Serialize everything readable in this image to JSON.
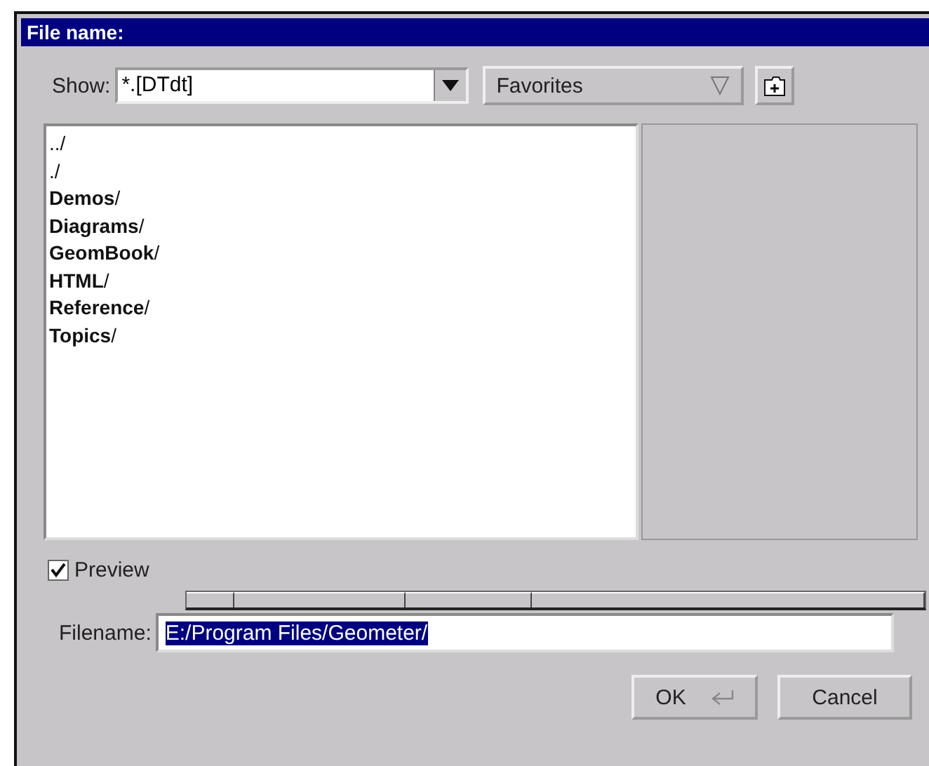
{
  "window": {
    "title": "File name:"
  },
  "filter": {
    "label": "Show:",
    "value": "*.[DTdt]"
  },
  "favorites": {
    "label": "Favorites"
  },
  "files": [
    {
      "name": "../"
    },
    {
      "name": "./"
    },
    {
      "name": "**Demos**/"
    },
    {
      "name": "**Diagrams**/"
    },
    {
      "name": "**GeomBook**/"
    },
    {
      "name": "**HTML**/"
    },
    {
      "name": "**Reference**/"
    },
    {
      "name": "**Topics**/"
    }
  ],
  "preview": {
    "label": "Preview",
    "checked": true
  },
  "filename": {
    "label": "Filename:",
    "value": "E:/Program Files/Geometer/",
    "text_selected": true
  },
  "buttons": [
    {
      "label": "OK",
      "kind": "ok"
    },
    {
      "label": "Cancel",
      "kind": "cancel"
    }
  ]
}
